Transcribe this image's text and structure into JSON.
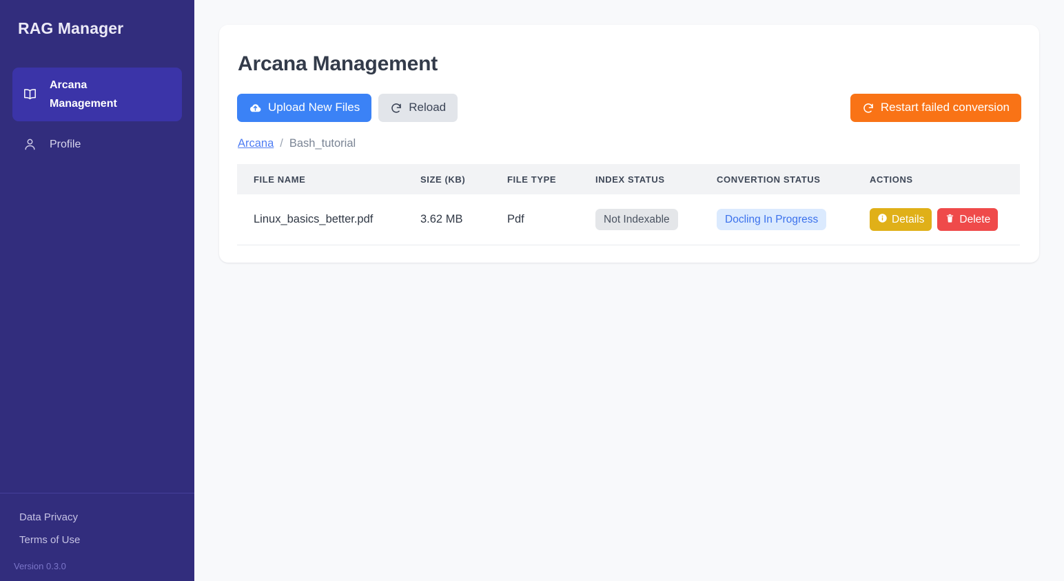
{
  "sidebar": {
    "brand": "RAG Manager",
    "items": [
      {
        "label": "Arcana Management",
        "icon": "book-open-icon",
        "active": true
      },
      {
        "label": "Profile",
        "icon": "user-icon",
        "active": false
      }
    ],
    "footer_links": [
      {
        "label": "Data Privacy"
      },
      {
        "label": "Terms of Use"
      }
    ],
    "version": "Version 0.3.0"
  },
  "main": {
    "page_title": "Arcana Management",
    "toolbar": {
      "upload_label": "Upload New Files",
      "upload_icon": "cloud-upload-icon",
      "reload_label": "Reload",
      "reload_icon": "refresh-icon",
      "restart_label": "Restart failed conversion",
      "restart_icon": "refresh-icon"
    },
    "breadcrumb": {
      "root": "Arcana",
      "separator": "/",
      "current": "Bash_tutorial"
    },
    "table": {
      "columns": [
        "FILE NAME",
        "SIZE (KB)",
        "FILE TYPE",
        "INDEX STATUS",
        "CONVERTION STATUS",
        "ACTIONS"
      ],
      "rows": [
        {
          "file_name": "Linux_basics_better.pdf",
          "size": "3.62 MB",
          "file_type": "Pdf",
          "index_status": "Not Indexable",
          "conversion_status": "Docling In Progress",
          "details_label": "Details",
          "delete_label": "Delete"
        }
      ]
    }
  },
  "colors": {
    "sidebar_bg": "#322d7d",
    "sidebar_active": "#3b34a8",
    "accent_blue": "#3b82f6",
    "accent_orange": "#f97316",
    "badge_gray_bg": "#e4e6e9",
    "badge_blue_bg": "#dbeafe",
    "badge_blue_text": "#3b71ec",
    "details_yellow": "#e0b018",
    "delete_red": "#ef4a4a",
    "page_bg": "#f8f9fb"
  }
}
